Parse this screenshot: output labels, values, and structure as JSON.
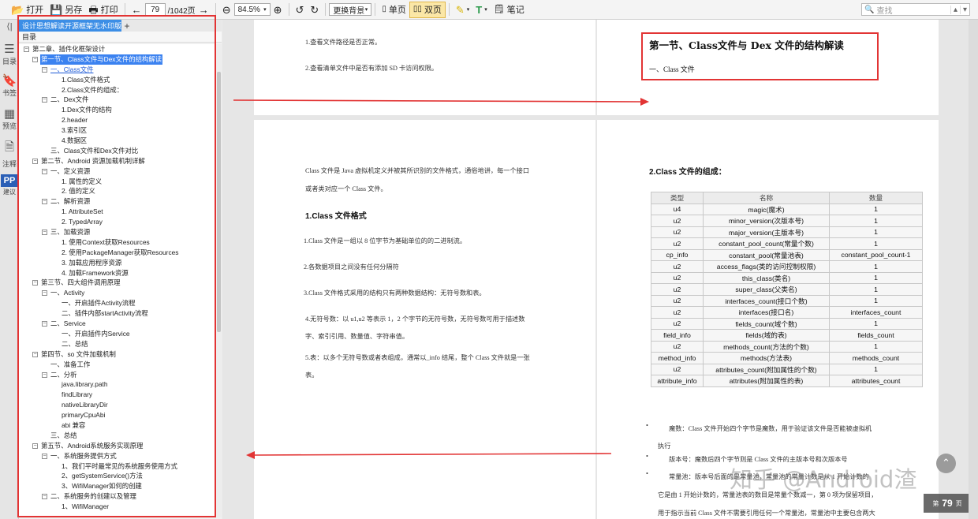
{
  "toolbar": {
    "open": "打开",
    "saveas": "另存",
    "print": "打印",
    "page_current": "79",
    "page_total": "/1042页",
    "zoom": "84.5%",
    "background": "更换背景",
    "single": "单页",
    "double": "双页",
    "notes": "笔记",
    "search_placeholder": "查找"
  },
  "leftbar": {
    "toc": "目录",
    "bookmark": "书签",
    "preview": "预览",
    "annot": "注释",
    "pp_badge": "PP",
    "pp_sub": "建议"
  },
  "tab": {
    "title": "设计思想解读开源框架无水印版",
    "close": "×",
    "add": "+"
  },
  "toc_header": "目录",
  "toc": [
    {
      "d": 0,
      "t": "第二章、插件化框架设计",
      "e": "minus"
    },
    {
      "d": 1,
      "t": "第一节、Class文件与Dex文件的结构解读",
      "e": "minus",
      "sel": true
    },
    {
      "d": 2,
      "t": "一、Class文件",
      "e": "minus",
      "link": true
    },
    {
      "d": 3,
      "t": "1.Class文件格式"
    },
    {
      "d": 3,
      "t": "2.Class文件的组成："
    },
    {
      "d": 2,
      "t": "二、Dex文件",
      "e": "minus"
    },
    {
      "d": 3,
      "t": "1.Dex文件的结构"
    },
    {
      "d": 3,
      "t": "2.header"
    },
    {
      "d": 3,
      "t": "3.索引区"
    },
    {
      "d": 3,
      "t": "4.数据区"
    },
    {
      "d": 2,
      "t": "三、Class文件和Dex文件对比"
    },
    {
      "d": 1,
      "t": "第二节、Android 资源加载机制详解",
      "e": "minus"
    },
    {
      "d": 2,
      "t": "一、定义资源",
      "e": "minus"
    },
    {
      "d": 3,
      "t": "1. 属性的定义"
    },
    {
      "d": 3,
      "t": "2. 值的定义"
    },
    {
      "d": 2,
      "t": "二、解析资源",
      "e": "minus"
    },
    {
      "d": 3,
      "t": "1. AttributeSet"
    },
    {
      "d": 3,
      "t": "2. TypedArray"
    },
    {
      "d": 2,
      "t": "三、加载资源",
      "e": "minus"
    },
    {
      "d": 3,
      "t": "1. 使用Context获取Resources"
    },
    {
      "d": 3,
      "t": "2. 使用PackageManager获取Resources"
    },
    {
      "d": 3,
      "t": "3. 加载应用程序资源"
    },
    {
      "d": 3,
      "t": "4. 加载Framework资源"
    },
    {
      "d": 1,
      "t": "第三节、四大组件调用原理",
      "e": "minus"
    },
    {
      "d": 2,
      "t": "一、Activity",
      "e": "minus"
    },
    {
      "d": 3,
      "t": "一、开启插件Activity流程"
    },
    {
      "d": 3,
      "t": "二、插件内部startActivity流程"
    },
    {
      "d": 2,
      "t": "二、Service",
      "e": "minus"
    },
    {
      "d": 3,
      "t": "一、开启插件内Service"
    },
    {
      "d": 3,
      "t": "二、总结"
    },
    {
      "d": 1,
      "t": "第四节、so 文件加载机制",
      "e": "minus"
    },
    {
      "d": 2,
      "t": "一、准备工作"
    },
    {
      "d": 2,
      "t": "二、分析",
      "e": "minus"
    },
    {
      "d": 3,
      "t": "java.library.path"
    },
    {
      "d": 3,
      "t": "findLibrary"
    },
    {
      "d": 3,
      "t": "nativeLibraryDir"
    },
    {
      "d": 3,
      "t": "primaryCpuAbi"
    },
    {
      "d": 3,
      "t": "abi 兼容"
    },
    {
      "d": 2,
      "t": "三、总结"
    },
    {
      "d": 1,
      "t": "第五节、Android系统服务实现原理",
      "e": "minus"
    },
    {
      "d": 2,
      "t": "一、系统服务提供方式",
      "e": "minus"
    },
    {
      "d": 3,
      "t": "1、我们平时最常见的系统服务使用方式"
    },
    {
      "d": 3,
      "t": "2、getSystemService()方法"
    },
    {
      "d": 3,
      "t": "3、WifiManager如何的创建"
    },
    {
      "d": 2,
      "t": "二、系统服务的创建以及管理",
      "e": "minus"
    },
    {
      "d": 3,
      "t": "1、WifiManager"
    }
  ],
  "left_page": {
    "top_lines": [
      "1.查看文件路径是否正常。",
      "2.查看清单文件中是否有添加 SD 卡访问权限。"
    ],
    "intro1": "Class 文件是 Java 虚拟机定义并被其所识别的文件格式，通俗地讲，每一个接口",
    "intro2": "或者类对应一个 Class 文件。",
    "heading": "1.Class 文件格式",
    "p1": "1.Class 文件是一组以 8 位字节为基础单位的的二进制流。",
    "p2": "2.各数据项目之间没有任何分隔符",
    "p3": "3.Class 文件格式采用的结构只有两种数据结构：无符号数和表。",
    "p4a": "4.无符号数：以 u1,u2 等表示 1，2 个字节的无符号数，无符号数可用于描述数",
    "p4b": "字、索引引用、数量值、字符串值。",
    "p5a": "5.表：以多个无符号数或者表组成，通常以_info 结尾，整个 Class 文件就是一张",
    "p5b": "表。"
  },
  "right_page": {
    "section_title": "第一节、Class文件与 Dex 文件的结构解读",
    "sub_title": "一、Class 文件",
    "composition_heading": "2.Class 文件的组成：",
    "table_headers": [
      "类型",
      "名称",
      "数量"
    ],
    "table_rows": [
      [
        "u4",
        "magic(魔术)",
        "1"
      ],
      [
        "u2",
        "minor_version(次版本号)",
        "1"
      ],
      [
        "u2",
        "major_version(主版本号)",
        "1"
      ],
      [
        "u2",
        "constant_pool_count(常量个数)",
        "1"
      ],
      [
        "cp_info",
        "constant_pool(常量池表)",
        "constant_pool_count-1"
      ],
      [
        "u2",
        "access_flags(类的访问控制权限)",
        "1"
      ],
      [
        "u2",
        "this_class(类名)",
        "1"
      ],
      [
        "u2",
        "super_class(父类名)",
        "1"
      ],
      [
        "u2",
        "interfaces_count(接口个数)",
        "1"
      ],
      [
        "u2",
        "interfaces(接口名)",
        "interfaces_count"
      ],
      [
        "u2",
        "fields_count(域个数)",
        "1"
      ],
      [
        "field_info",
        "fields(域的表)",
        "fields_count"
      ],
      [
        "u2",
        "methods_count(方法的个数)",
        "1"
      ],
      [
        "method_info",
        "methods(方法表)",
        "methods_count"
      ],
      [
        "u2",
        "attributes_count(附加属性的个数)",
        "1"
      ],
      [
        "attribute_info",
        "attributes(附加属性的表)",
        "attributes_count"
      ]
    ],
    "b1a": "魔数：Class 文件开始四个字节是魔数，用于验证该文件是否能被虚拟机",
    "b1b": "执行",
    "b2": "版本号：魔数后四个字节则是 Class 文件的主版本号和次版本号",
    "b3": "常量池：版本号后面的是常量池，常量池的常量计数是从 1 开始计数的",
    "b4": "它是由 1 开始计数的，常量池表的数目是常量个数减一，第 0 项为保留项目，",
    "b5": "用于指示当前 Class 文件不需要引用任何一个常量池，常量池中主要包含两大"
  },
  "watermark": "知乎 @Android渣",
  "page_badge": {
    "prefix": "第",
    "num": "79",
    "suffix": "页"
  }
}
